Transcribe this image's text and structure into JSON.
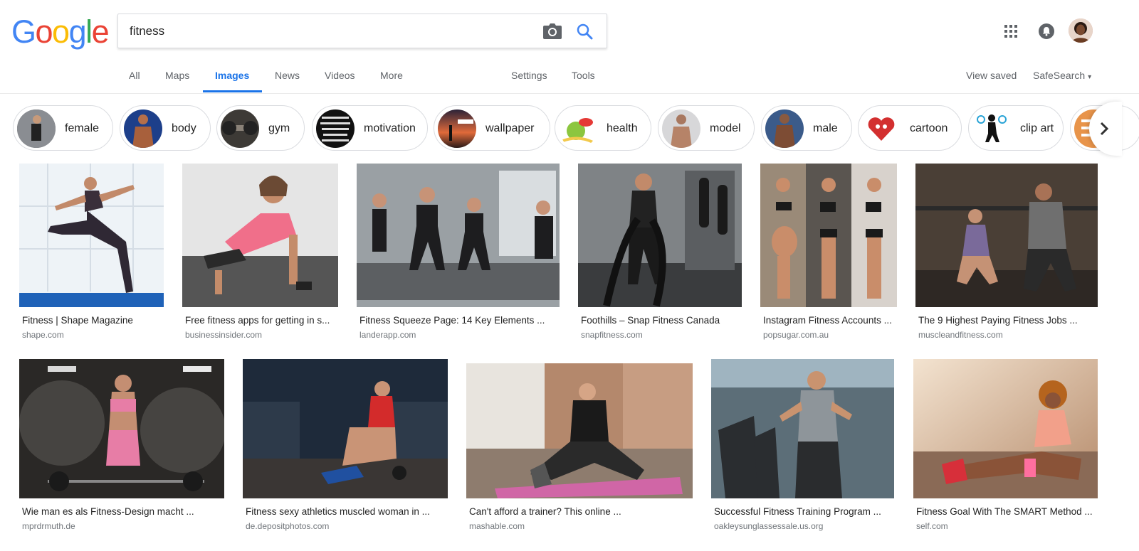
{
  "logo": {
    "text": "Google"
  },
  "search": {
    "query": "fitness"
  },
  "nav": {
    "tabs": [
      "All",
      "Maps",
      "Images",
      "News",
      "Videos",
      "More",
      "Settings",
      "Tools"
    ],
    "active": "Images",
    "view_saved": "View saved",
    "safesearch": "SafeSearch"
  },
  "chips": [
    "female",
    "body",
    "gym",
    "motivation",
    "wallpaper",
    "health",
    "model",
    "male",
    "cartoon",
    "clip art"
  ],
  "results_row1": [
    {
      "title": "Fitness | Shape Magazine",
      "domain": "shape.com"
    },
    {
      "title": "Free fitness apps for getting in s...",
      "domain": "businessinsider.com"
    },
    {
      "title": "Fitness Squeeze Page: 14 Key Elements ...",
      "domain": "landerapp.com"
    },
    {
      "title": "Foothills – Snap Fitness Canada",
      "domain": "snapfitness.com"
    },
    {
      "title": "Instagram Fitness Accounts ...",
      "domain": "popsugar.com.au"
    },
    {
      "title": "The 9 Highest Paying Fitness Jobs ...",
      "domain": "muscleandfitness.com"
    }
  ],
  "results_row2": [
    {
      "title": "Wie man es als Fitness-Design macht ...",
      "domain": "mprdrmuth.de"
    },
    {
      "title": "Fitness sexy athletics muscled woman in ...",
      "domain": "de.depositphotos.com"
    },
    {
      "title": "Can't afford a trainer? This online ...",
      "domain": "mashable.com"
    },
    {
      "title": "Successful Fitness Training Program ...",
      "domain": "oakleysunglassessale.us.org"
    },
    {
      "title": "Fitness Goal With The SMART Method ...",
      "domain": "self.com"
    }
  ],
  "colors": {
    "blue": "#4285F4",
    "red": "#EA4335",
    "yellow": "#FBBC05",
    "green": "#34A853",
    "accent": "#1a73e8"
  }
}
